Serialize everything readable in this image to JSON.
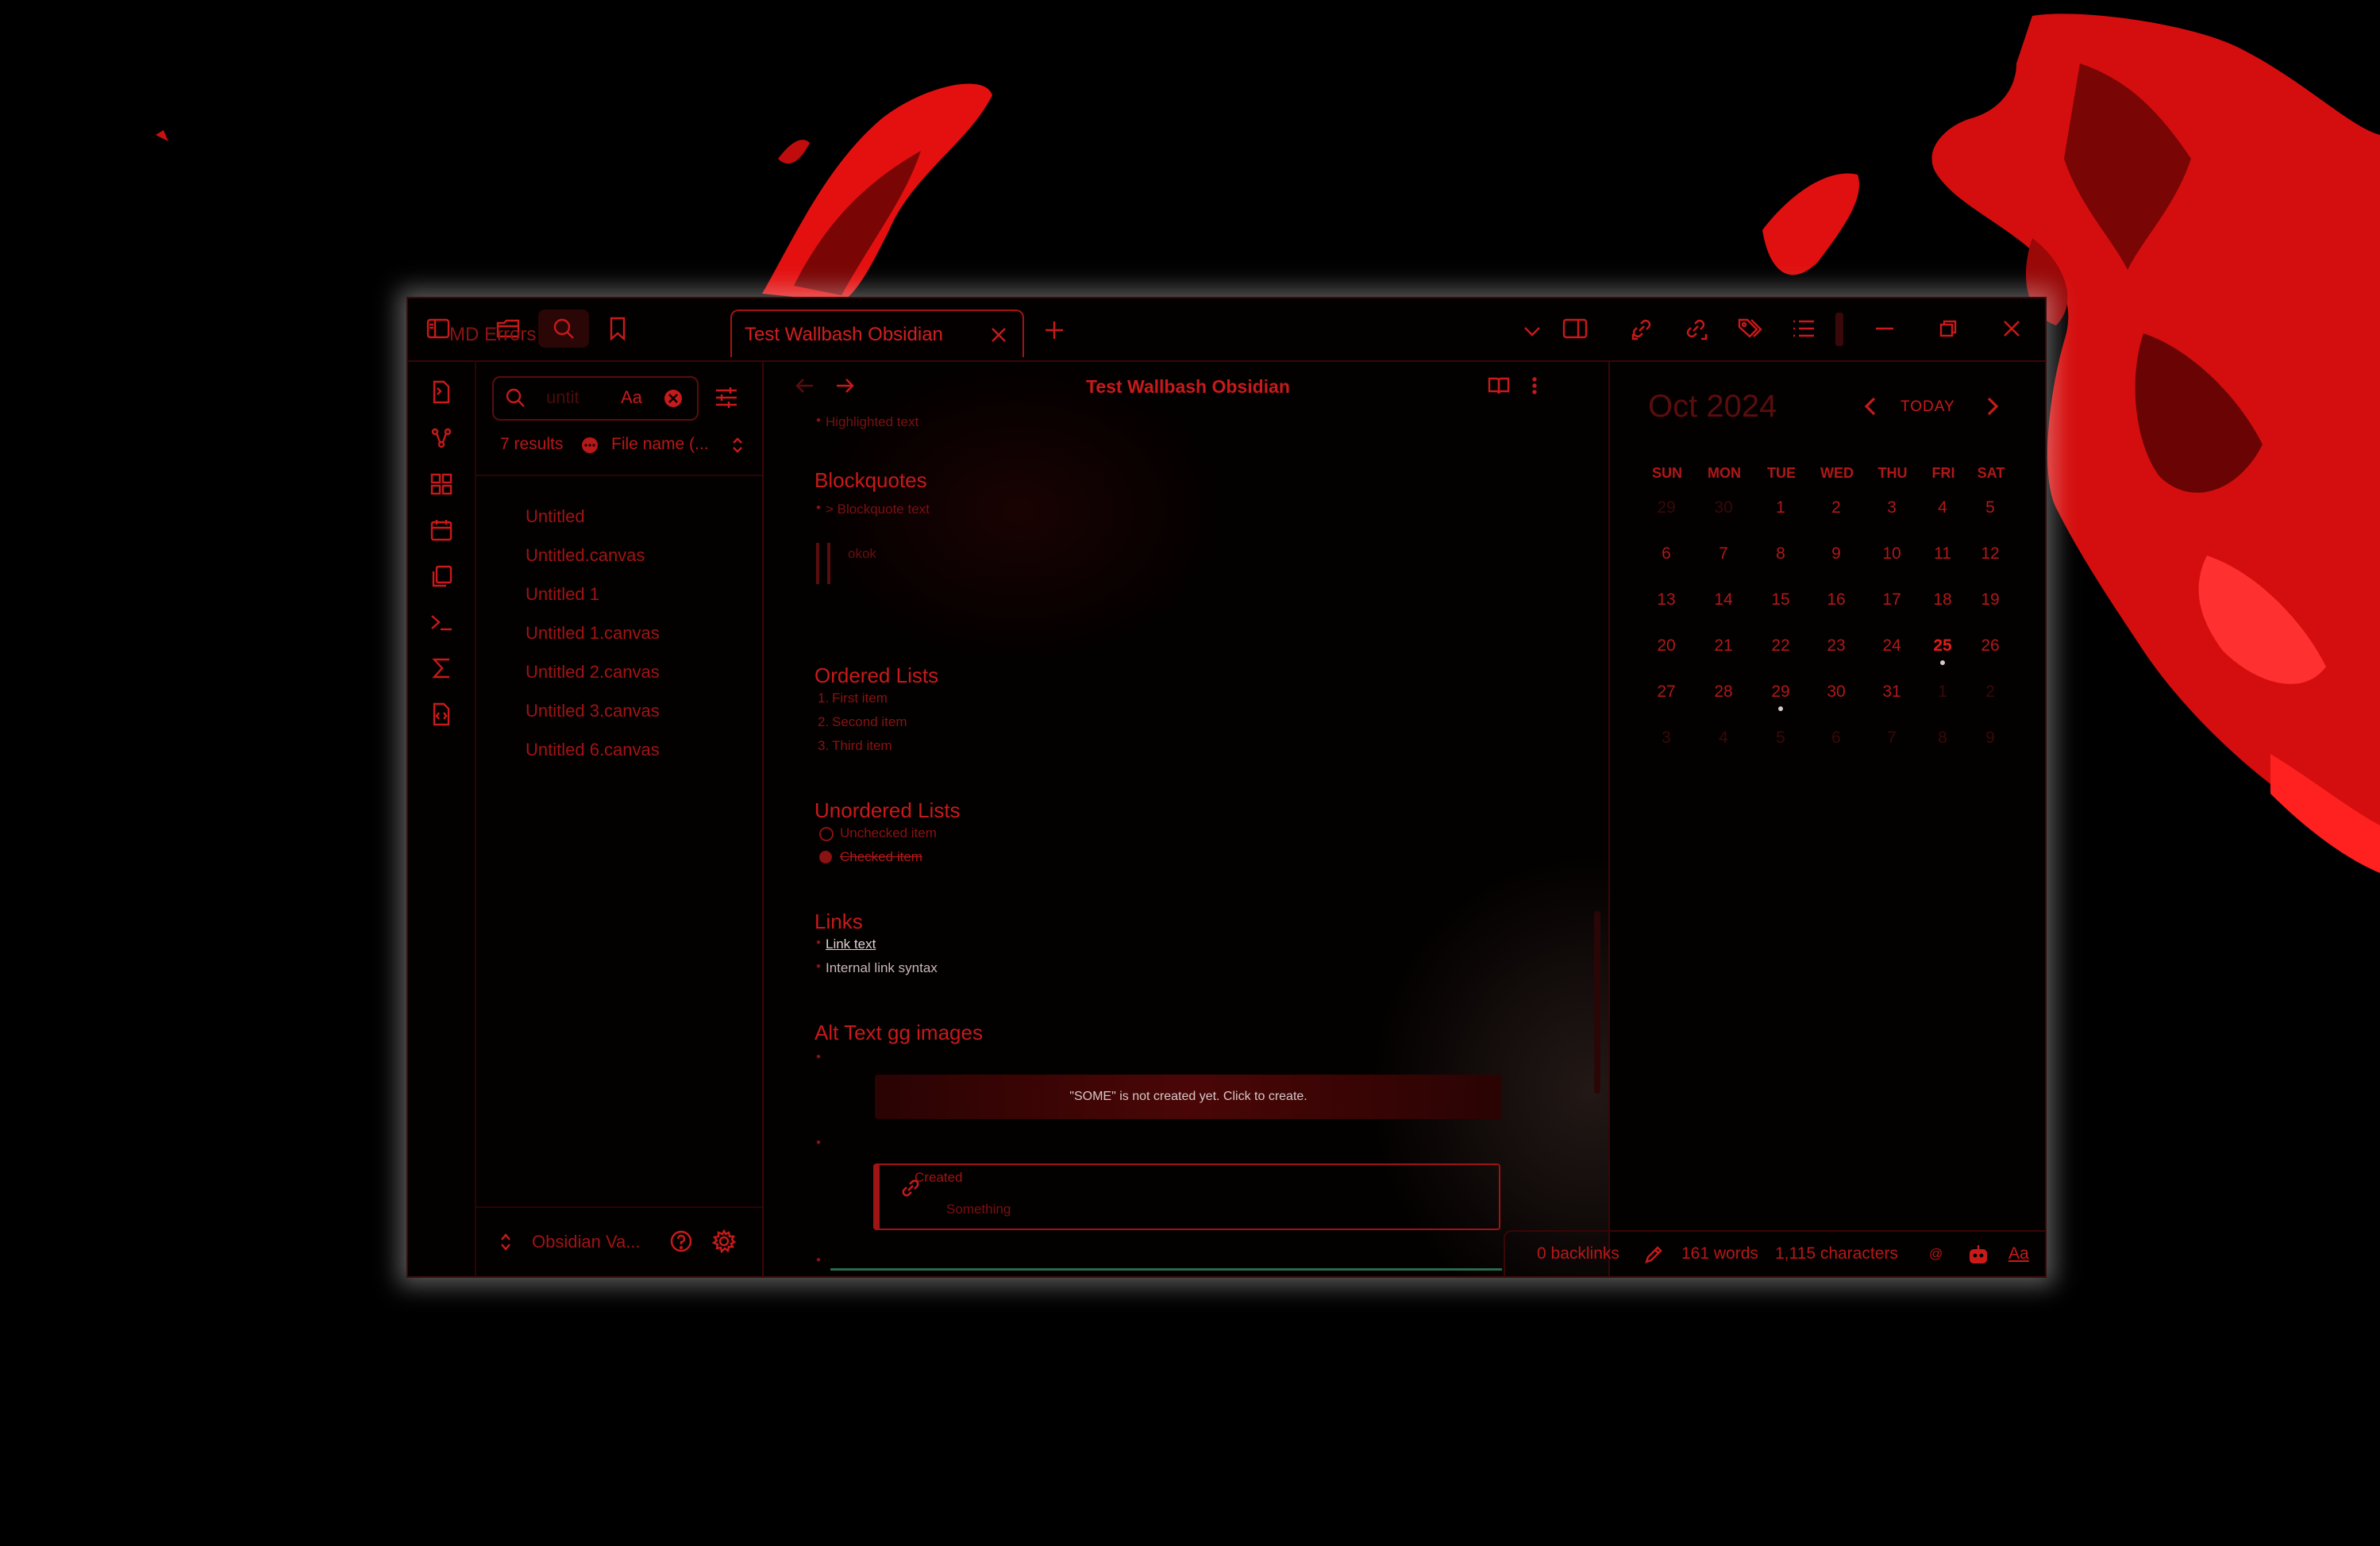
{
  "colors": {
    "accent": "#c81a1a",
    "background": "#000000",
    "window": "#030000",
    "dim": "#3a0808"
  },
  "tabs": {
    "inactive": "MD Errors",
    "active": "Test Wallbash Obsidian"
  },
  "search": {
    "value": "untit",
    "case_label": "Aa",
    "results": "7 results",
    "sort": "File name (..."
  },
  "files": [
    "Untitled",
    "Untitled.canvas",
    "Untitled 1",
    "Untitled 1.canvas",
    "Untitled 2.canvas",
    "Untitled 3.canvas",
    "Untitled 6.canvas"
  ],
  "vault": {
    "name": "Obsidian Va..."
  },
  "editor": {
    "title": "Test Wallbash Obsidian",
    "highlighted": "Highlighted text",
    "blockquotes_heading": "Blockquotes",
    "blockquote_item": "> Blockquote text",
    "blockquote_text": "okok",
    "ordered_heading": "Ordered Lists",
    "ordered": [
      "First item",
      "Second item",
      "Third item"
    ],
    "unordered_heading": "Unordered Lists",
    "unchecked": "Unchecked item",
    "checked": "Checked item",
    "links_heading": "Links",
    "link_text": "Link text",
    "internal_link": "Internal link syntax",
    "alt_heading": "Alt Text gg images",
    "not_created": "\"SOME\" is not created yet. Click to create.",
    "created_label": "Created",
    "created_body": "Something"
  },
  "calendar": {
    "month": "Oct 2024",
    "today_label": "TODAY",
    "weekdays": [
      "SUN",
      "MON",
      "TUE",
      "WED",
      "THU",
      "FRI",
      "SAT"
    ],
    "weeks": [
      [
        "29",
        "30",
        "1",
        "2",
        "3",
        "4",
        "5"
      ],
      [
        "6",
        "7",
        "8",
        "9",
        "10",
        "11",
        "12"
      ],
      [
        "13",
        "14",
        "15",
        "16",
        "17",
        "18",
        "19"
      ],
      [
        "20",
        "21",
        "22",
        "23",
        "24",
        "25",
        "26"
      ],
      [
        "27",
        "28",
        "29",
        "30",
        "31",
        "1",
        "2"
      ],
      [
        "3",
        "4",
        "5",
        "6",
        "7",
        "8",
        "9"
      ]
    ],
    "today": "25"
  },
  "status": {
    "backlinks": "0 backlinks",
    "words": "161 words",
    "characters": "1,115 characters",
    "at": "@",
    "font": "Aa"
  },
  "icons": [
    "sidebar-toggle-icon",
    "folder-icon",
    "search-icon",
    "bookmark-icon",
    "close-icon",
    "plus-icon",
    "chevron-down-icon",
    "right-sidebar-icon",
    "backlink-icon",
    "outgoing-link-icon",
    "tags-icon",
    "outline-icon",
    "minimize-icon",
    "restore-icon",
    "window-close-icon"
  ]
}
